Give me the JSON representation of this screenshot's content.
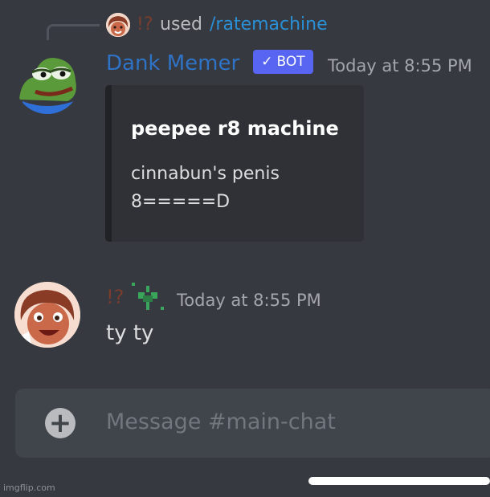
{
  "reply": {
    "user_name": "!?",
    "used_text": "used",
    "command": "/ratemachine"
  },
  "bot_message": {
    "author": "Dank Memer",
    "tag": "BOT",
    "tag_icon": "checkmark-icon",
    "timestamp": "Today at 8:55 PM",
    "embed": {
      "title": "peepee r8 machine",
      "line1": "cinnabun's penis",
      "line2": "8=====D"
    }
  },
  "user_message": {
    "author": "!?",
    "timestamp": "Today at 8:55 PM",
    "text": "ty ty"
  },
  "composer": {
    "add_icon": "plus-icon",
    "placeholder": "Message #main-chat"
  },
  "watermark": "imgflip.com",
  "colors": {
    "background": "#36393f",
    "bot_name": "#2f73c7",
    "bot_tag": "#5865f2",
    "command_link": "#2b8fd6",
    "user_name": "#7a3d2d"
  }
}
